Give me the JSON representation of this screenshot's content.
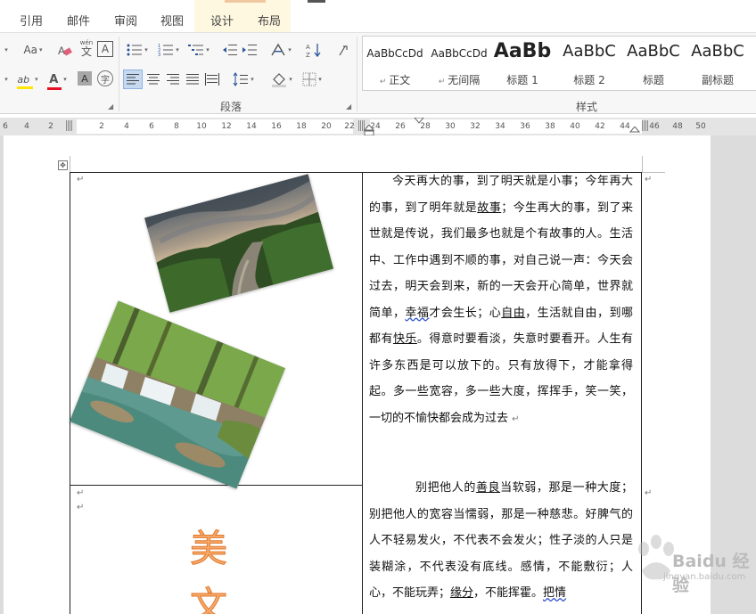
{
  "tabs": [
    {
      "label": "引用"
    },
    {
      "label": "邮件"
    },
    {
      "label": "审阅"
    },
    {
      "label": "视图"
    },
    {
      "label": "设计"
    },
    {
      "label": "布局"
    }
  ],
  "ribbon": {
    "font_row1": {
      "size_label": "Aa",
      "pinyin_label": "wén"
    },
    "font_row2": {
      "highlight_letter": "ab",
      "font_color_letter": "A",
      "char_shade_letter": "A",
      "enclose_char": "字"
    },
    "paragraph_group_label": "段落",
    "styles_group_label": "样式",
    "styles": [
      {
        "sample": "AaBbCcDd",
        "name": "正文"
      },
      {
        "sample": "AaBbCcDd",
        "name": "无间隔"
      },
      {
        "sample": "AaBb",
        "name": "标题 1"
      },
      {
        "sample": "AaBbC",
        "name": "标题 2"
      },
      {
        "sample": "AaBbC",
        "name": "标题"
      },
      {
        "sample": "AaBbC",
        "name": "副标题"
      }
    ]
  },
  "ruler": {
    "numbers": [
      "6",
      "4",
      "2",
      "2",
      "4",
      "6",
      "8",
      "10",
      "12",
      "14",
      "16",
      "18",
      "20",
      "22",
      "24",
      "26",
      "28",
      "30",
      "32",
      "34",
      "36",
      "38",
      "40",
      "42",
      "44",
      "46",
      "48",
      "50"
    ]
  },
  "document": {
    "paragraph1_parts": [
      {
        "text": "今天再大的事，到了明天就是小事；今年再大的事，到了明年就是",
        "style": ""
      },
      {
        "text": "故事",
        "style": "u"
      },
      {
        "text": "；今生再大的事，到了来世就是传说，我们最多也就是个有故事的人。生活中、工作中遇到不顺的事，对自己说一声：今天会过去，明天会到来，新的一天会开心简单，世界就简单，",
        "style": ""
      },
      {
        "text": "幸福",
        "style": "uw"
      },
      {
        "text": "才会生长；心",
        "style": ""
      },
      {
        "text": "自由",
        "style": "u"
      },
      {
        "text": "，生活就自由，到哪都有",
        "style": ""
      },
      {
        "text": "快乐",
        "style": "u"
      },
      {
        "text": "。得意时要看淡，失意时要看开。人生有许多东西是可以放下的。只有放得下，才能拿得起。多一些宽容，多一些大度，挥挥手，笑一笑，一切的不愉快都会成为过去",
        "style": ""
      }
    ],
    "paragraph2_parts": [
      {
        "text": "别把他人的",
        "style": ""
      },
      {
        "text": "善良",
        "style": "u"
      },
      {
        "text": "当软弱，那是一种大度；别把他人的宽容当懦弱，那是一种慈悲。好脾气的人不轻易发火，不代表不会发火；性子淡的人只是装糊涂，不代表没有底线。感情，不能敷衍；人心，不能玩弄；",
        "style": ""
      },
      {
        "text": "缘分",
        "style": "u"
      },
      {
        "text": "，不能挥霍。",
        "style": ""
      },
      {
        "text": "把情",
        "style": "uw"
      }
    ],
    "big_chars": [
      "美",
      "文"
    ]
  },
  "watermark": {
    "brand": "Baidu 经验",
    "url": "jingyan.baidu.com"
  },
  "colors": {
    "accent": "#c55a11",
    "title_char": "#f6a869",
    "wavy_underline": "#3355cc"
  }
}
